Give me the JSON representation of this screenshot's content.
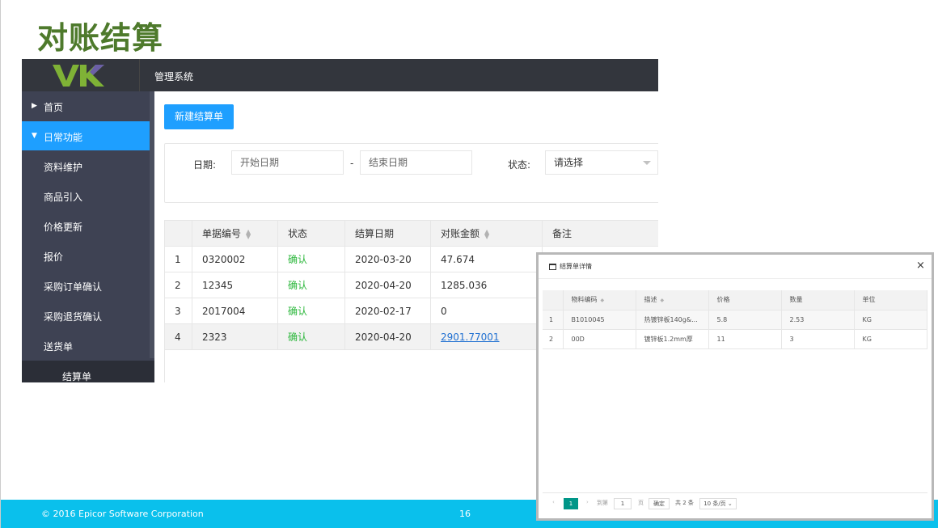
{
  "slide_title": "对账结算",
  "app": {
    "title": "管理系统",
    "logo_text": "VK"
  },
  "sidebar": {
    "items": [
      {
        "label": "首页"
      },
      {
        "label": "日常功能"
      },
      {
        "label": "资料维护"
      },
      {
        "label": "商品引入"
      },
      {
        "label": "价格更新"
      },
      {
        "label": "报价"
      },
      {
        "label": "采购订单确认"
      },
      {
        "label": "采购退货确认"
      },
      {
        "label": "送货单"
      },
      {
        "label": "结算单"
      }
    ]
  },
  "toolbar": {
    "new_button": "新建结算单"
  },
  "filter": {
    "date_label": "日期:",
    "start_placeholder": "开始日期",
    "dash": "-",
    "end_placeholder": "结束日期",
    "status_label": "状态:",
    "status_value": "请选择"
  },
  "table": {
    "headers": [
      "单据编号",
      "状态",
      "结算日期",
      "对账金额",
      "备注"
    ],
    "rows": [
      {
        "index": "1",
        "no": "0320002",
        "status": "确认",
        "date": "2020-03-20",
        "amount": "47.674"
      },
      {
        "index": "2",
        "no": "12345",
        "status": "确认",
        "date": "2020-04-20",
        "amount": "1285.036"
      },
      {
        "index": "3",
        "no": "2017004",
        "status": "确认",
        "date": "2020-02-17",
        "amount": "0"
      },
      {
        "index": "4",
        "no": "2323",
        "status": "确认",
        "date": "2020-04-20",
        "amount": "2901.77001"
      }
    ]
  },
  "modal": {
    "title": "结算单详情",
    "close": "×",
    "headers": [
      "物料编码",
      "描述",
      "价格",
      "数量",
      "单位"
    ],
    "rows": [
      {
        "index": "1",
        "code": "B1010045",
        "desc": "热镀锌板140g&...",
        "price": "5.8",
        "qty": "2.53",
        "unit": "KG"
      },
      {
        "index": "2",
        "code": "00D",
        "desc": "镀锌板1.2mm厚",
        "price": "11",
        "qty": "3",
        "unit": "KG"
      }
    ],
    "pager": {
      "prev": "‹",
      "current": "1",
      "next": "›",
      "goto_label": "到第",
      "goto_value": "1",
      "page_unit": "页",
      "confirm": "确定",
      "total": "共 2 条",
      "per_page": "10 条/页"
    }
  },
  "footer": {
    "copyright": "© 2016 Epicor Software Corporation",
    "page_number": "16"
  },
  "colors": {
    "accent": "#1e9fff",
    "sidebar_bg": "#3e4253",
    "topbar_bg": "#33363d",
    "title_green": "#4e7a2c",
    "status_green": "#2bb73b",
    "footer_bg": "#0ac0ec",
    "pager_current": "#009688"
  }
}
